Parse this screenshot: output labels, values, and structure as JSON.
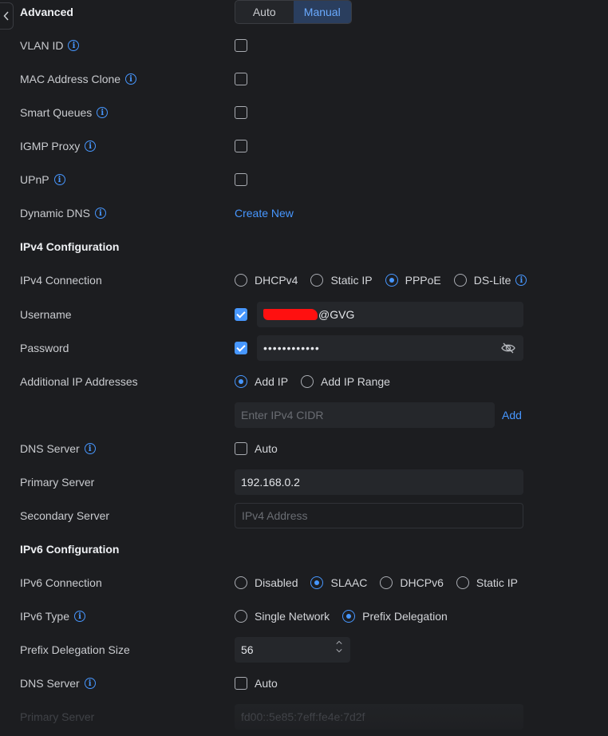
{
  "advanced": {
    "title": "Advanced",
    "modes": [
      "Auto",
      "Manual"
    ],
    "active_mode": "Manual"
  },
  "toggles": [
    {
      "label": "VLAN ID",
      "checked": false
    },
    {
      "label": "MAC Address Clone",
      "checked": false
    },
    {
      "label": "Smart Queues",
      "checked": false
    },
    {
      "label": "IGMP Proxy",
      "checked": false
    },
    {
      "label": "UPnP",
      "checked": false
    }
  ],
  "dynamic_dns": {
    "label": "Dynamic DNS",
    "action": "Create New"
  },
  "ipv4": {
    "title": "IPv4 Configuration",
    "connection_label": "IPv4 Connection",
    "connection_options": [
      "DHCPv4",
      "Static IP",
      "PPPoE",
      "DS-Lite"
    ],
    "connection_selected": "PPPoE",
    "username_label": "Username",
    "username_value": "@GVG",
    "username_checked": true,
    "password_label": "Password",
    "password_value": "••••••••••••",
    "password_checked": true,
    "additional_label": "Additional IP Addresses",
    "additional_options": [
      "Add IP",
      "Add IP Range"
    ],
    "additional_selected": "Add IP",
    "cidr_placeholder": "Enter IPv4 CIDR",
    "add_label": "Add",
    "dns_label": "DNS Server",
    "dns_auto_label": "Auto",
    "dns_auto_checked": false,
    "primary_label": "Primary Server",
    "primary_value": "192.168.0.2",
    "secondary_label": "Secondary Server",
    "secondary_placeholder": "IPv4 Address"
  },
  "ipv6": {
    "title": "IPv6 Configuration",
    "connection_label": "IPv6 Connection",
    "connection_options": [
      "Disabled",
      "SLAAC",
      "DHCPv6",
      "Static IP"
    ],
    "connection_selected": "SLAAC",
    "type_label": "IPv6 Type",
    "type_options": [
      "Single Network",
      "Prefix Delegation"
    ],
    "type_selected": "Prefix Delegation",
    "pd_size_label": "Prefix Delegation Size",
    "pd_size_value": "56",
    "dns_label": "DNS Server",
    "dns_auto_label": "Auto",
    "dns_auto_checked": false,
    "primary_label": "Primary Server",
    "primary_value": "fd00::5e85:7eff:fe4e:7d2f"
  },
  "colors": {
    "accent": "#4797ff",
    "background": "#1c1d20",
    "field": "#25272b"
  },
  "icons": {
    "back": "chevron-left-icon",
    "info": "info-icon",
    "password_toggle": "eye-off-icon"
  }
}
